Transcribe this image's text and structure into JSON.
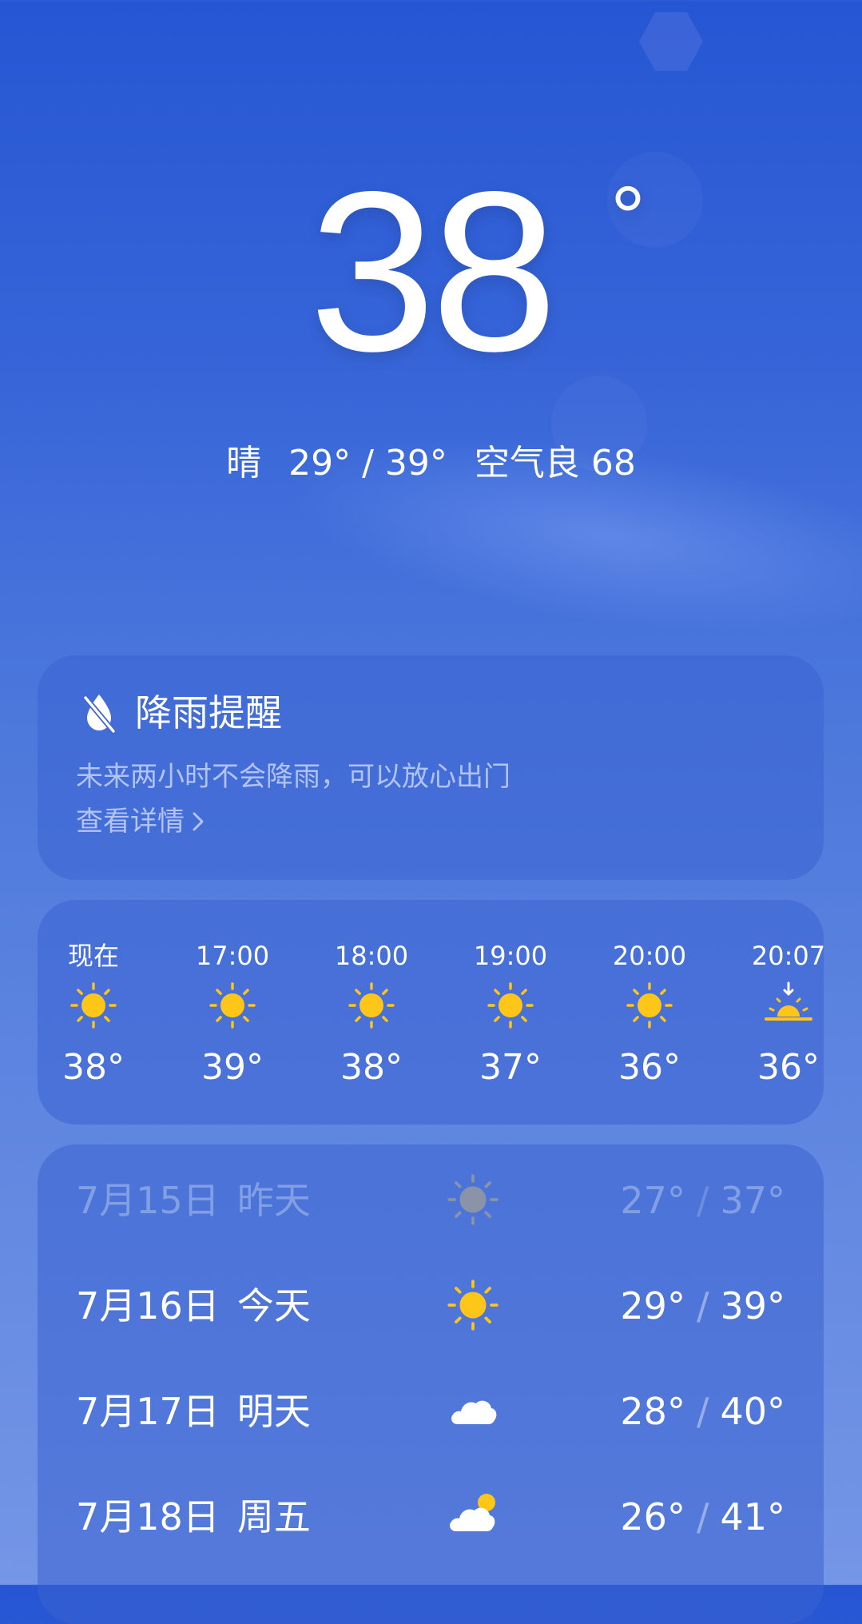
{
  "current": {
    "temperature": "38",
    "degree_symbol": "°",
    "condition": "晴",
    "temp_range": "29° / 39°",
    "air_quality": "空气良 68"
  },
  "rain_alert": {
    "title": "降雨提醒",
    "description": "未来两小时不会降雨，可以放心出门",
    "link_label": "查看详情"
  },
  "hourly": [
    {
      "time": "现在",
      "icon": "sun-icon",
      "temp": "38°"
    },
    {
      "time": "17:00",
      "icon": "sun-icon",
      "temp": "39°"
    },
    {
      "time": "18:00",
      "icon": "sun-icon",
      "temp": "38°"
    },
    {
      "time": "19:00",
      "icon": "sun-icon",
      "temp": "37°"
    },
    {
      "time": "20:00",
      "icon": "sun-icon",
      "temp": "36°"
    },
    {
      "time": "20:07",
      "icon": "sunset-icon",
      "temp": "36°"
    }
  ],
  "daily": [
    {
      "date": "7月15日",
      "day": "昨天",
      "icon": "sun-icon",
      "low": "27°",
      "high": "37°",
      "past": true
    },
    {
      "date": "7月16日",
      "day": "今天",
      "icon": "sun-icon",
      "low": "29°",
      "high": "39°",
      "past": false
    },
    {
      "date": "7月17日",
      "day": "明天",
      "icon": "cloud-icon",
      "low": "28°",
      "high": "40°",
      "past": false
    },
    {
      "date": "7月18日",
      "day": "周五",
      "icon": "partly-cloudy-icon",
      "low": "26°",
      "high": "41°",
      "past": false
    }
  ],
  "colors": {
    "sun": "#FFC61A",
    "sun_past": "#8A93A8",
    "cloud": "#FFFFFF"
  }
}
